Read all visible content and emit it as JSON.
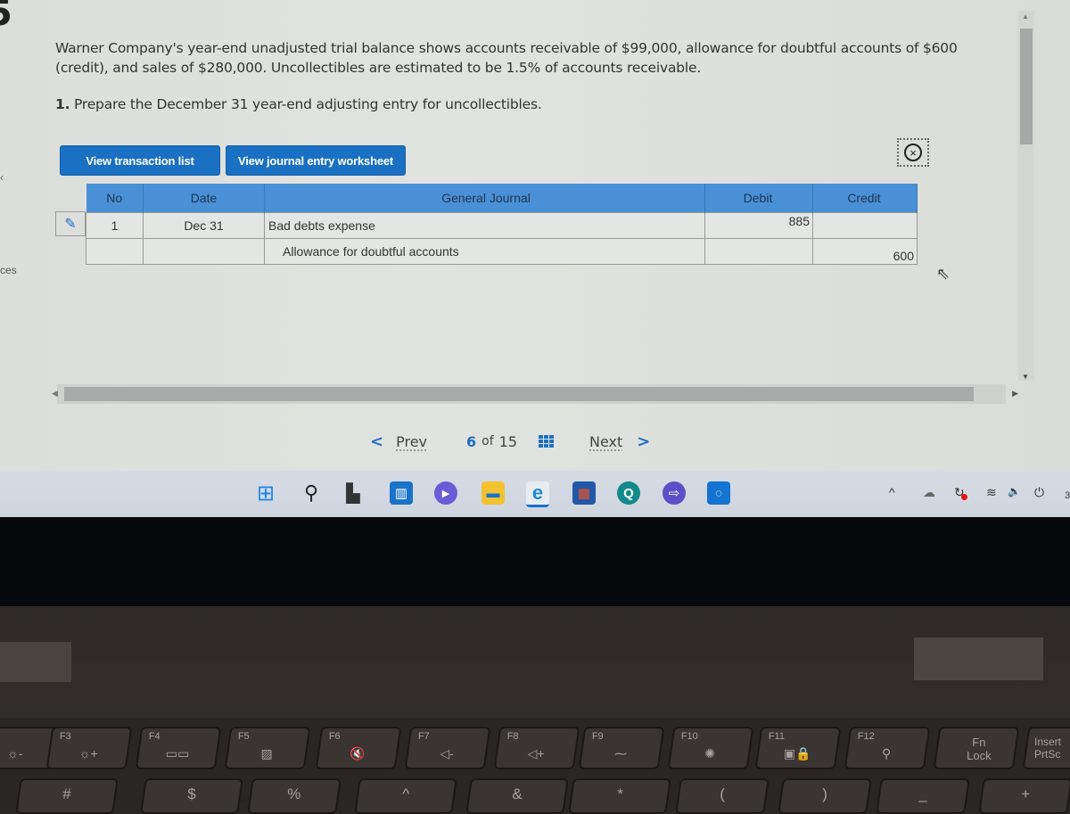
{
  "page": {
    "left_edge": {
      "logo_glyph": "5",
      "chevron": "‹",
      "partial_label": "ces"
    },
    "question": {
      "text": "Warner Company's year-end unadjusted trial balance shows accounts receivable of $99,000, allowance for doubtful accounts of $600 (credit), and sales of $280,000. Uncollectibles are estimated to be 1.5% of accounts receivable.",
      "instruction_num": "1.",
      "instruction": "Prepare the December 31 year-end adjusting entry for uncollectibles."
    },
    "buttons": {
      "view_transaction_list": "View transaction list",
      "view_journal_worksheet": "View journal entry worksheet",
      "close_glyph": "×"
    },
    "journal": {
      "columns": [
        "No",
        "Date",
        "General Journal",
        "Debit",
        "Credit"
      ],
      "edit_glyph": "✎",
      "rows": [
        {
          "no": "1",
          "date": "Dec 31",
          "account": "Bad debts expense",
          "debit": "885",
          "credit": ""
        },
        {
          "no": "",
          "date": "",
          "account": "Allowance for doubtful accounts",
          "debit": "",
          "credit": "600"
        }
      ]
    },
    "scroll": {
      "left_arrow": "◀",
      "right_arrow": "▶",
      "up_arrow": "▲",
      "down_arrow": "▼"
    },
    "pager": {
      "prev_chevron": "<",
      "prev": "Prev",
      "current": "6",
      "of": "of",
      "total": "15",
      "next": "Next",
      "next_chevron": ">"
    },
    "cursor_glyph": "⇖"
  },
  "taskbar": {
    "icons": [
      {
        "name": "start",
        "glyph": "⊞",
        "color": "#1a86e8"
      },
      {
        "name": "search",
        "glyph": "⚲",
        "color": "#222222"
      },
      {
        "name": "task-view",
        "glyph": "▙",
        "color": "#333333"
      },
      {
        "name": "widgets",
        "glyph": "▥",
        "color": "#1a73c8"
      },
      {
        "name": "teams-chat",
        "glyph": "▶",
        "color": "#6b5bd6"
      },
      {
        "name": "file-explorer",
        "glyph": "▬",
        "color": "#f2c230"
      },
      {
        "name": "edge",
        "glyph": "e",
        "color": "#1a8ad8"
      },
      {
        "name": "store",
        "glyph": "▦",
        "color": "#2158a8"
      },
      {
        "name": "search-app",
        "glyph": "Q",
        "color": "#138a8a"
      },
      {
        "name": "remote-app",
        "glyph": "⇨",
        "color": "#5b4fc8"
      },
      {
        "name": "cortana",
        "glyph": "○",
        "color": "#1472d0"
      }
    ],
    "tray": {
      "chevron": "^",
      "cloud": "☁",
      "sync": "↻",
      "wifi": "≋",
      "volume": "🔈",
      "battery": "⏻",
      "clock_partial": "3"
    }
  },
  "keyboard": {
    "fn_row": [
      {
        "label": "",
        "icon": "☼-"
      },
      {
        "label": "F3",
        "icon": "☼+"
      },
      {
        "label": "F4",
        "icon": "▭▭"
      },
      {
        "label": "F5",
        "icon": "▨"
      },
      {
        "label": "F6",
        "icon": "🔇"
      },
      {
        "label": "F7",
        "icon": "◁-"
      },
      {
        "label": "F8",
        "icon": "◁+"
      },
      {
        "label": "F9",
        "icon": "⁓"
      },
      {
        "label": "F10",
        "icon": "✺"
      },
      {
        "label": "F11",
        "icon": "▣🔒"
      },
      {
        "label": "F12",
        "icon": "⚲"
      },
      {
        "label": "Fn Lock",
        "icon": ""
      },
      {
        "label": "Insert PrtSc",
        "icon": ""
      }
    ],
    "num_row": [
      "",
      "#",
      "$",
      "%",
      "^",
      "&",
      "*",
      "(",
      ")",
      "_",
      "+"
    ]
  }
}
